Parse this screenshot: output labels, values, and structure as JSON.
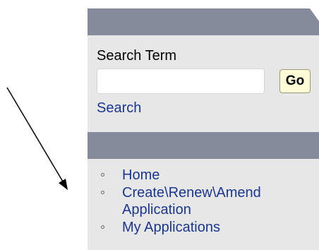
{
  "search": {
    "label": "Search Term",
    "input_value": "",
    "input_placeholder": "",
    "go_label": "Go",
    "link_label": "Search"
  },
  "nav": {
    "items": [
      {
        "label": "Home",
        "icon": "circle-bullet-icon"
      },
      {
        "label": "Create\\Renew\\Amend Application",
        "icon": "circle-bullet-icon"
      },
      {
        "label": "My Applications",
        "icon": "circle-bullet-icon"
      }
    ]
  },
  "colors": {
    "header_bar": "#858b9a",
    "panel_bg": "#e7e7e7",
    "link": "#1a3694",
    "go_button_bg": "#fdfcd6",
    "arrow": "#000000"
  }
}
